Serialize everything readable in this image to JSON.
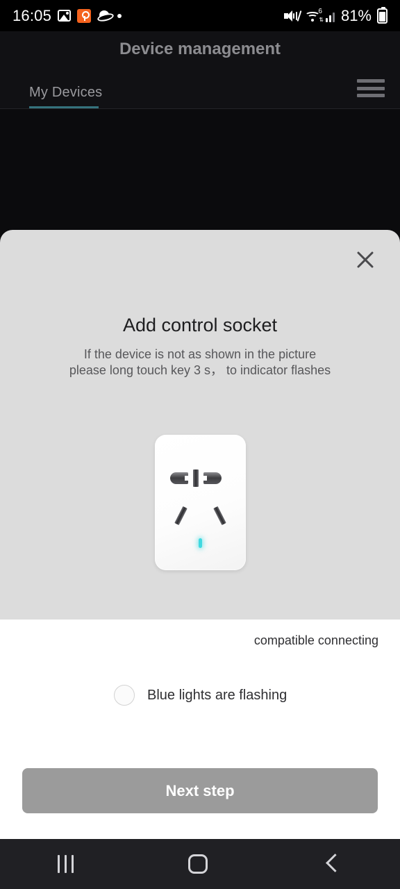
{
  "status_bar": {
    "clock": "16:05",
    "battery_percent": "81%",
    "left_icons": [
      "photo-icon",
      "key-icon",
      "planet-icon",
      "dot-icon"
    ],
    "right_icons": [
      "mute-icon",
      "wifi6-icon",
      "signal-icon",
      "battery-icon"
    ]
  },
  "header": {
    "title": "Device management",
    "tabs": [
      {
        "label": "My Devices",
        "active": true
      }
    ],
    "menu_icon": "hamburger-menu-icon",
    "accent_color": "#35737d"
  },
  "sheet": {
    "close_icon": "close-icon",
    "title": "Add control socket",
    "subtitle_line1": "If the device is not as shown in the picture",
    "subtitle_line2": "please long touch key 3 s， to indicator flashes",
    "device_image": {
      "name": "wall-socket-illustration",
      "led_color": "#3fd9e0",
      "body_color": "#ffffff"
    },
    "background_color": "#dcdcdc"
  },
  "lower_panel": {
    "compatible_text": "compatible connecting",
    "checkbox": {
      "label": "Blue lights are flashing",
      "checked": false
    },
    "next_button": {
      "label": "Next step",
      "enabled": false,
      "color": "#9b9b9b"
    }
  },
  "nav_bar": {
    "recents_icon": "recents-icon",
    "home_icon": "home-icon",
    "back_icon": "back-icon"
  }
}
